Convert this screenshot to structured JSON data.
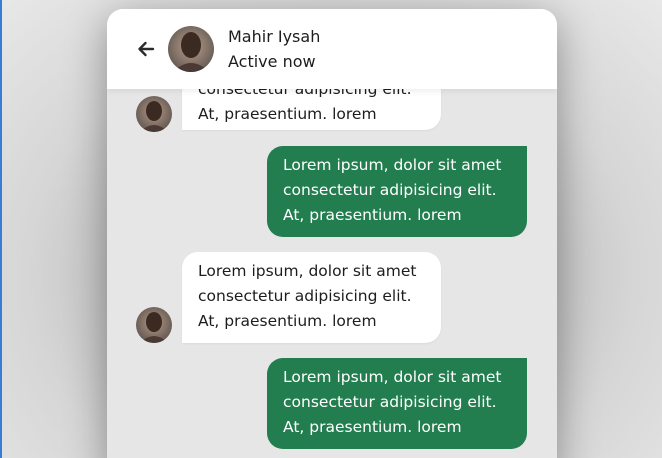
{
  "header": {
    "contact_name": "Mahir Iysah",
    "status": "Active now",
    "back_icon": "arrow-left-icon",
    "avatar": "contact-avatar"
  },
  "messages": [
    {
      "direction": "received",
      "lines": [
        "consectetur adipisicing elit.",
        "At, praesentium. lorem"
      ]
    },
    {
      "direction": "sent",
      "lines": [
        "Lorem ipsum, dolor sit amet",
        "consectetur adipisicing elit.",
        "At, praesentium. lorem"
      ]
    },
    {
      "direction": "received",
      "lines": [
        "Lorem ipsum, dolor sit amet",
        "consectetur adipisicing elit.",
        "At, praesentium. lorem"
      ]
    },
    {
      "direction": "sent",
      "lines": [
        "Lorem ipsum, dolor sit amet",
        "consectetur adipisicing elit.",
        "At, praesentium. lorem"
      ]
    }
  ],
  "colors": {
    "sent_bubble": "#227d4f",
    "received_bubble": "#ffffff",
    "chat_background": "#e6e6e6"
  }
}
